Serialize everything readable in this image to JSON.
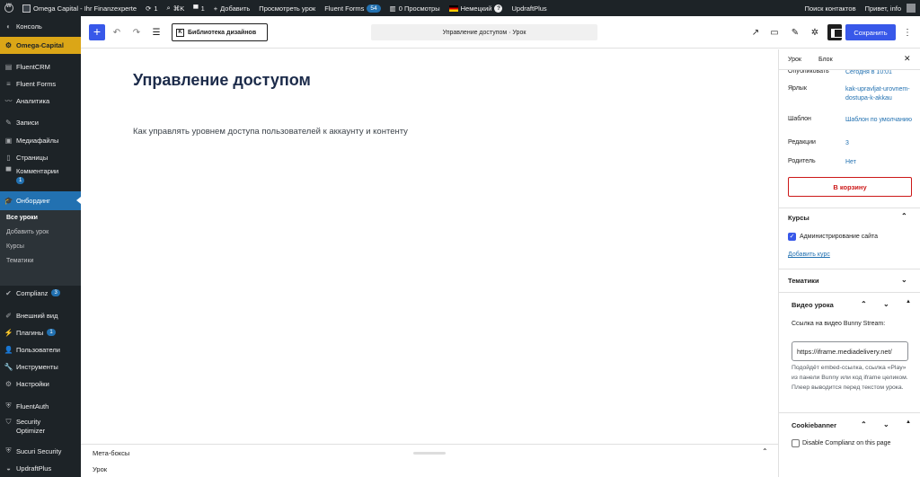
{
  "adminbar": {
    "site_name": "Omega Capital - Ihr Finanzexperte",
    "updates_count": "1",
    "search_shortcut": "⌘K",
    "comments_count": "1",
    "add_new": "Добавить",
    "view_lesson": "Просмотреть урок",
    "fluent_forms": "Fluent Forms",
    "fluent_forms_badge": "54",
    "views": "0 Просмотры",
    "language": "Немецкий",
    "updraft": "UpdraftPlus",
    "search_contacts": "Поиск контактов",
    "greeting": "Привет, info"
  },
  "menu": {
    "konsol": "Консоль",
    "omega": "Omega-Capital",
    "fluentcrm": "FluentCRM",
    "fluentforms": "Fluent Forms",
    "analytics": "Аналитика",
    "posts": "Записи",
    "media": "Медиафайлы",
    "pages": "Страницы",
    "comments": "Комментарии",
    "comments_badge": "1",
    "onboarding": "Онбординг",
    "sub_all": "Все уроки",
    "sub_add": "Добавить урок",
    "sub_courses": "Курсы",
    "sub_topics": "Тематики",
    "complianz": "Complianz",
    "complianz_badge": "3",
    "appearance": "Внешний вид",
    "plugins": "Плагины",
    "plugins_badge": "1",
    "users": "Пользователи",
    "tools": "Инструменты",
    "settings": "Настройки",
    "fluentauth": "FluentAuth",
    "security": "Security Optimizer",
    "sucuri": "Sucuri Security",
    "updraft": "UpdraftPlus"
  },
  "header": {
    "design_library": "Библиотека дизайнов",
    "doc_title": "Управление доступом · Урок",
    "save": "Сохранить"
  },
  "content": {
    "title": "Управление доступом",
    "paragraph": "Как управлять уровнем доступа пользователей к аккаунту и контенту"
  },
  "metabar": {
    "label": "Мета-боксы",
    "breadcrumb": "Урок"
  },
  "sidebar": {
    "tab_lesson": "Урок",
    "tab_block": "Блок",
    "publish_label": "Опубликовать",
    "publish_value": "Сегодня в 10:01",
    "slug_label": "Ярлык",
    "slug_value": "kak-upravljat-urovnem-dostupa-k-akkau",
    "template_label": "Шаблон",
    "template_value": "Шаблон по умолчанию",
    "revisions_label": "Редакции",
    "revisions_value": "3",
    "parent_label": "Родитель",
    "parent_value": "Нет",
    "trash": "В корзину",
    "courses_title": "Курсы",
    "course_item": "Администрирование сайта",
    "add_course": "Добавить курс",
    "topics_title": "Тематики",
    "video_title": "Видео урока",
    "video_label": "Ссылка на видео Bunny Stream:",
    "video_value": "https://iframe.mediadelivery.net/",
    "video_help": "Подойдёт embed-ссылка, ссылка «Play» из панели Bunny или код iframe целиком. Плеер выводится перед текстом урока.",
    "cookie_title": "Cookiebanner",
    "cookie_option": "Disable Complianz on this page"
  },
  "colors": {
    "wp_dark": "#1d2327",
    "accent_blue": "#3858e9",
    "omega_gold": "#dba617",
    "danger": "#cc1818"
  }
}
